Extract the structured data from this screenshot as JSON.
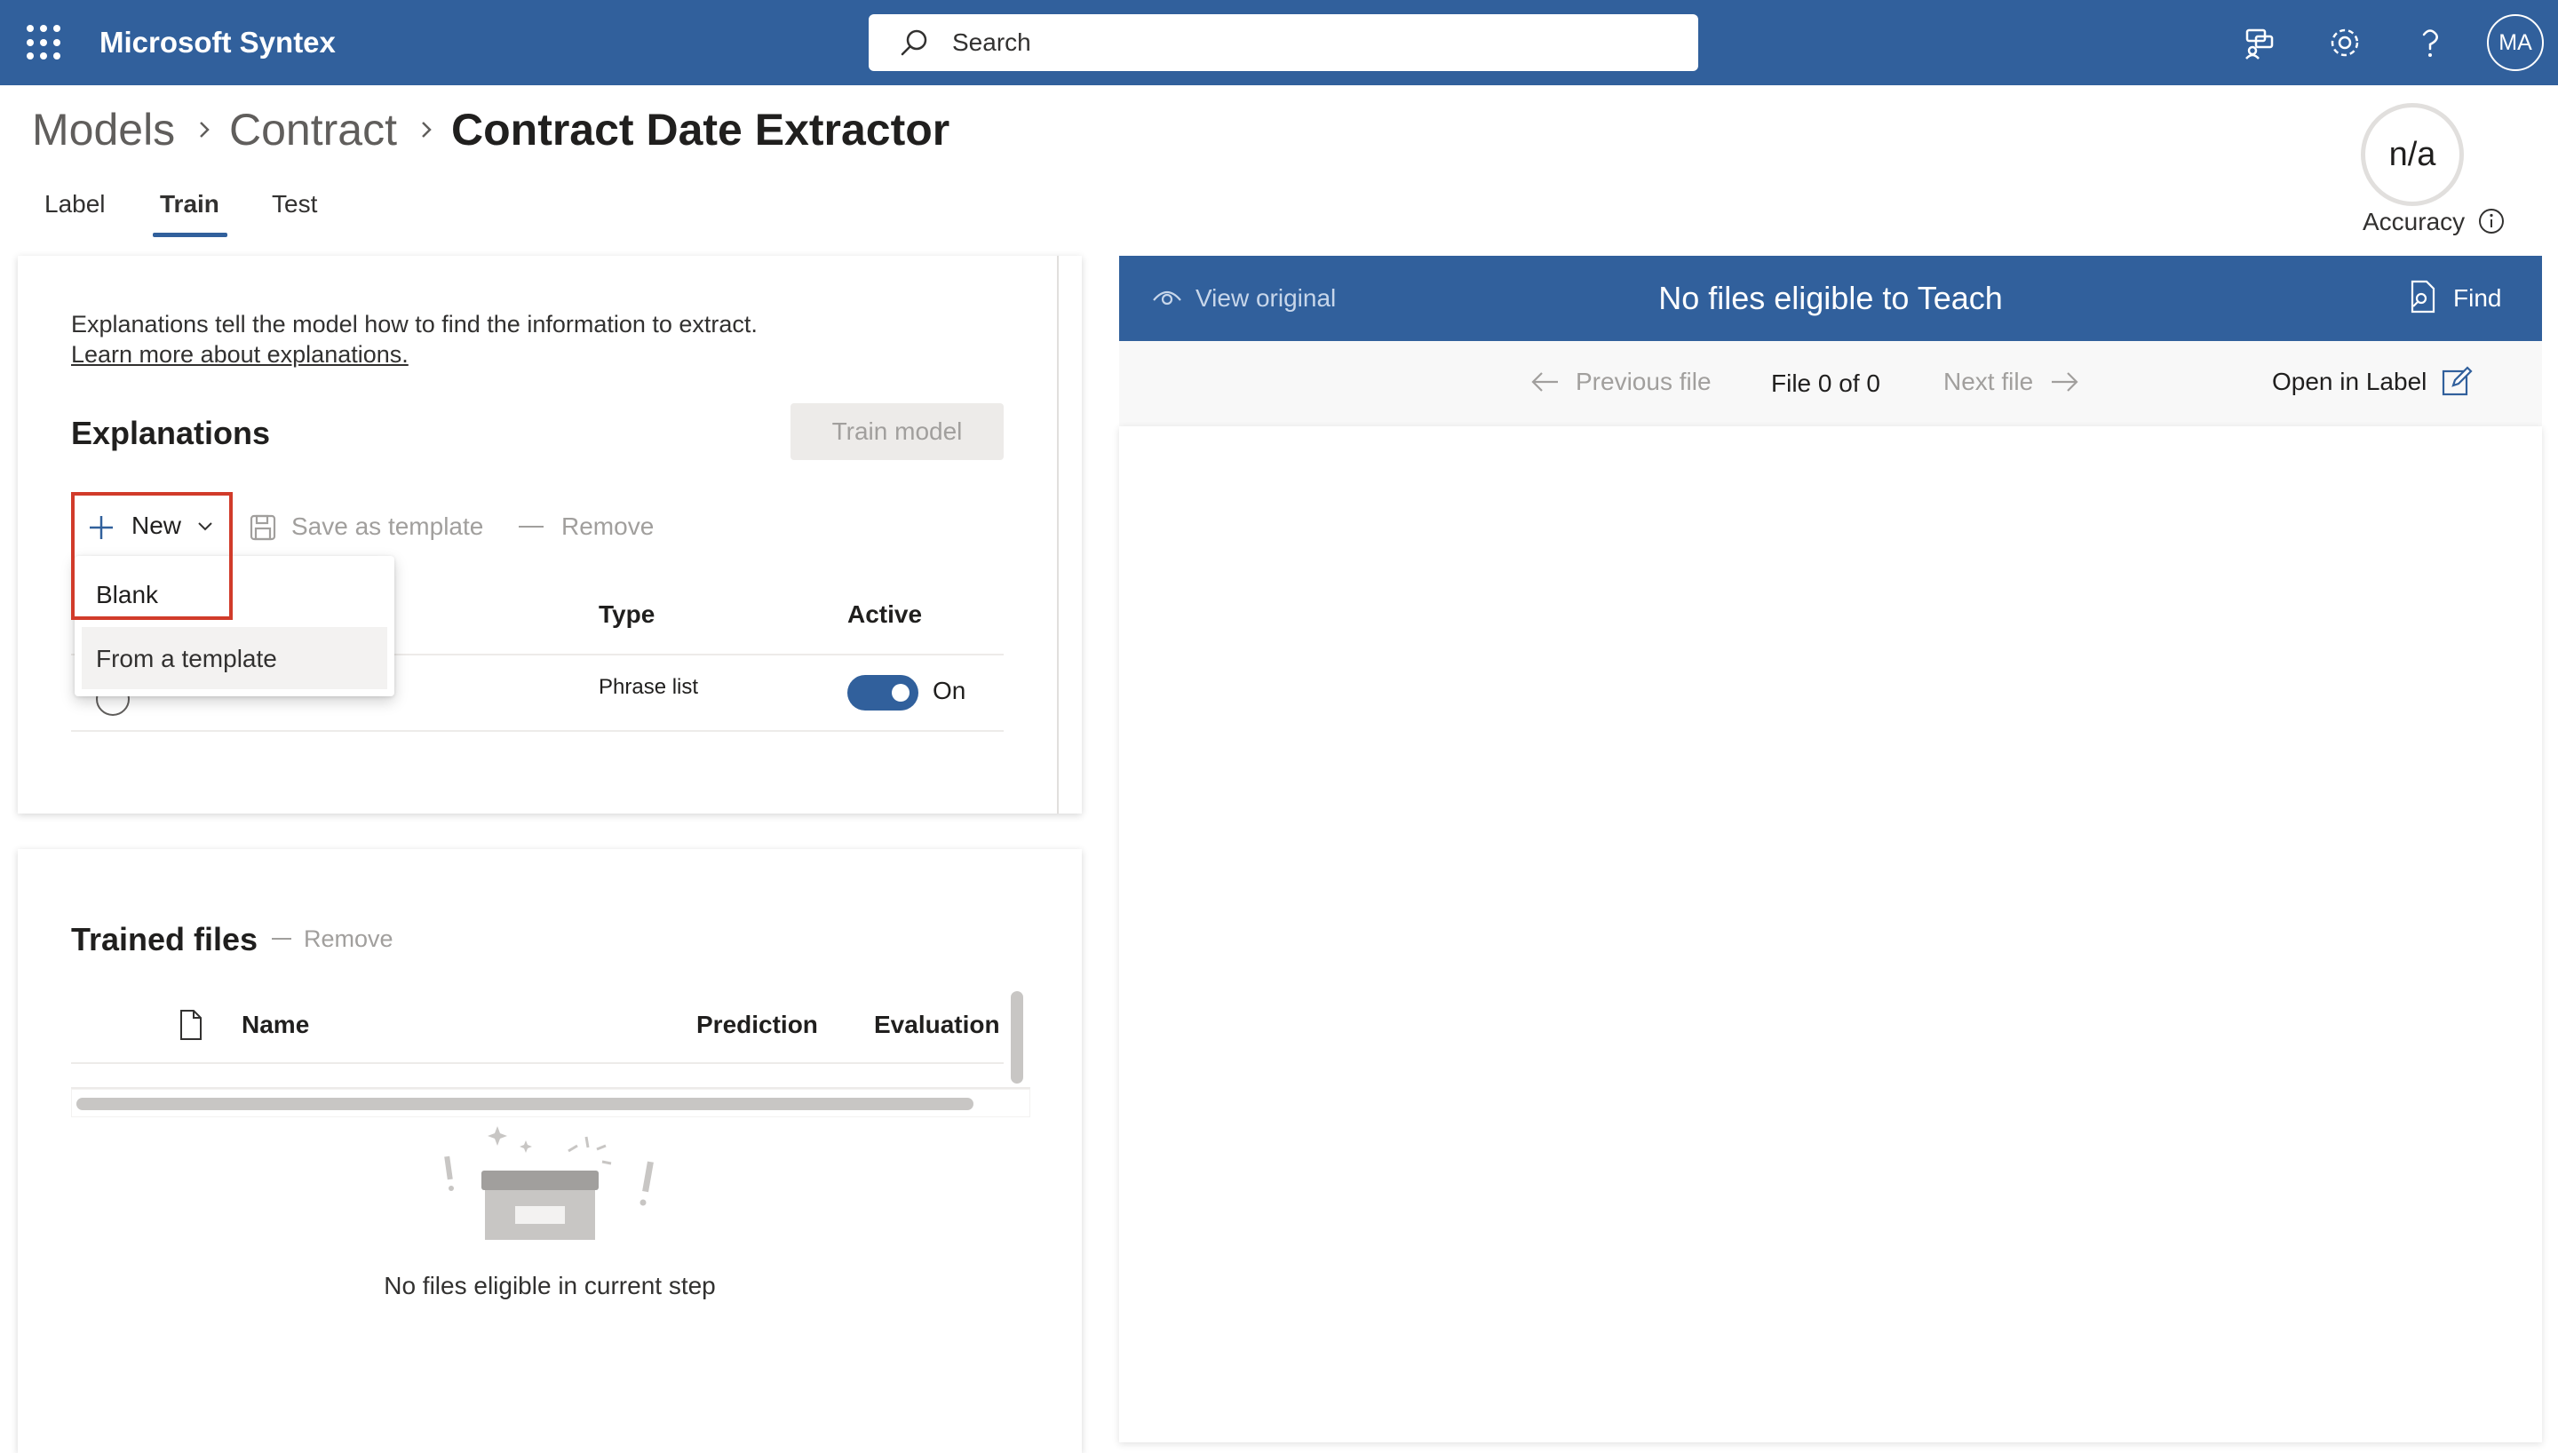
{
  "app": {
    "title": "Microsoft Syntex"
  },
  "search": {
    "placeholder": "Search"
  },
  "header_icons": [
    "community-icon",
    "gear-icon",
    "help-icon"
  ],
  "user": {
    "initials": "MA"
  },
  "breadcrumb": [
    "Models",
    "Contract",
    "Contract Date Extractor"
  ],
  "tabs": [
    {
      "label": "Label",
      "selected": false
    },
    {
      "label": "Train",
      "selected": true
    },
    {
      "label": "Test",
      "selected": false
    }
  ],
  "accuracy": {
    "value": "n/a",
    "label": "Accuracy"
  },
  "explanations": {
    "description": "Explanations tell the model how to find the information to extract.",
    "learn_more": "Learn more about explanations.",
    "heading": "Explanations",
    "train_button": "Train model",
    "commands": {
      "new": "New",
      "save_as_template": "Save as template",
      "remove": "Remove"
    },
    "columns": {
      "type": "Type",
      "active": "Active"
    },
    "rows": [
      {
        "type": "Phrase list",
        "active_label": "On",
        "active": true
      }
    ],
    "new_menu": {
      "items": [
        "Blank",
        "From a template"
      ],
      "highlighted": "Blank"
    }
  },
  "trained_files": {
    "heading": "Trained files",
    "remove": "Remove",
    "columns": {
      "name": "Name",
      "prediction": "Prediction",
      "evaluation": "Evaluation"
    },
    "empty_message": "No files eligible in current step"
  },
  "viewer": {
    "view_original": "View original",
    "title": "No files eligible to Teach",
    "find": "Find",
    "previous_file": "Previous file",
    "file_count": "File 0 of 0",
    "next_file": "Next file",
    "open_in_label": "Open in Label"
  },
  "colors": {
    "brand": "#31609c",
    "highlight": "#d13b2a",
    "disabled_text": "#a19f9d"
  }
}
